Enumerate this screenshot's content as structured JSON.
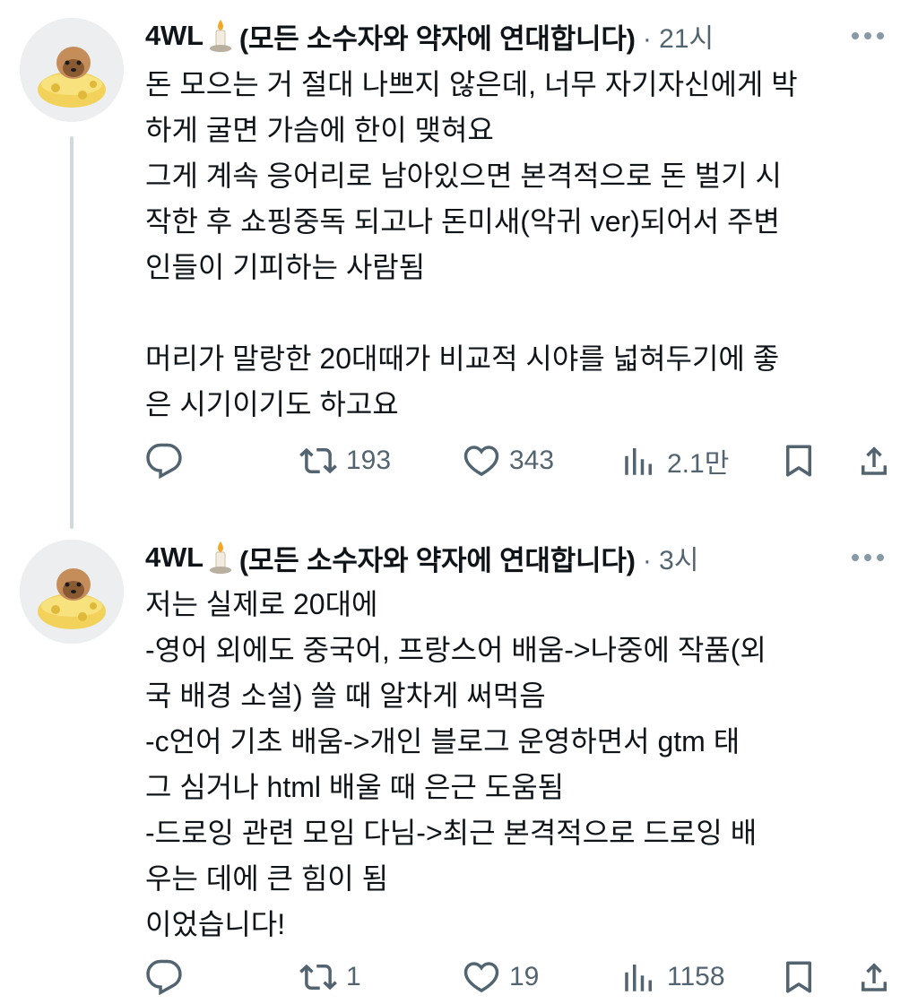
{
  "colors": {
    "text": "#0f1419",
    "secondary": "#536471",
    "thread_line": "#cfd9de"
  },
  "tweets": [
    {
      "author": {
        "display_name": "4WL",
        "suffix": "(모든 소수자와 약자에 연대합니다)",
        "emoji": "candle",
        "avatar": "pomeranian-dog-avatar"
      },
      "time": "· 21시",
      "text": "돈 모으는 거 절대 나쁘지 않은데, 너무 자기자신에게 박\n하게 굴면 가슴에 한이 맺혀요\n그게 계속 응어리로 남아있으면 본격적으로 돈 벌기 시\n작한 후 쇼핑중독 되고나 돈미새(악귀 ver)되어서 주변\n인들이 기피하는 사람됨\n\n머리가 말랑한 20대때가 비교적 시야를 넓혀두기에 좋\n은 시기이기도 하고요",
      "actions": {
        "retweets": "193",
        "likes": "343",
        "views": "2.1만"
      }
    },
    {
      "author": {
        "display_name": "4WL",
        "suffix": "(모든 소수자와 약자에 연대합니다)",
        "emoji": "candle",
        "avatar": "pomeranian-dog-avatar"
      },
      "time": "· 3시",
      "text": "저는 실제로 20대에\n-영어 외에도 중국어, 프랑스어 배움->나중에 작품(외\n국 배경 소설) 쓸 때 알차게 써먹음\n-c언어 기초 배움->개인 블로그 운영하면서 gtm 태\n그 심거나 html 배울 때 은근 도움됨\n-드로잉 관련 모임 다님->최근 본격적으로 드로잉 배\n우는 데에 큰 힘이 됨\n이었습니다!",
      "actions": {
        "retweets": "1",
        "likes": "19",
        "views": "1158"
      }
    }
  ]
}
